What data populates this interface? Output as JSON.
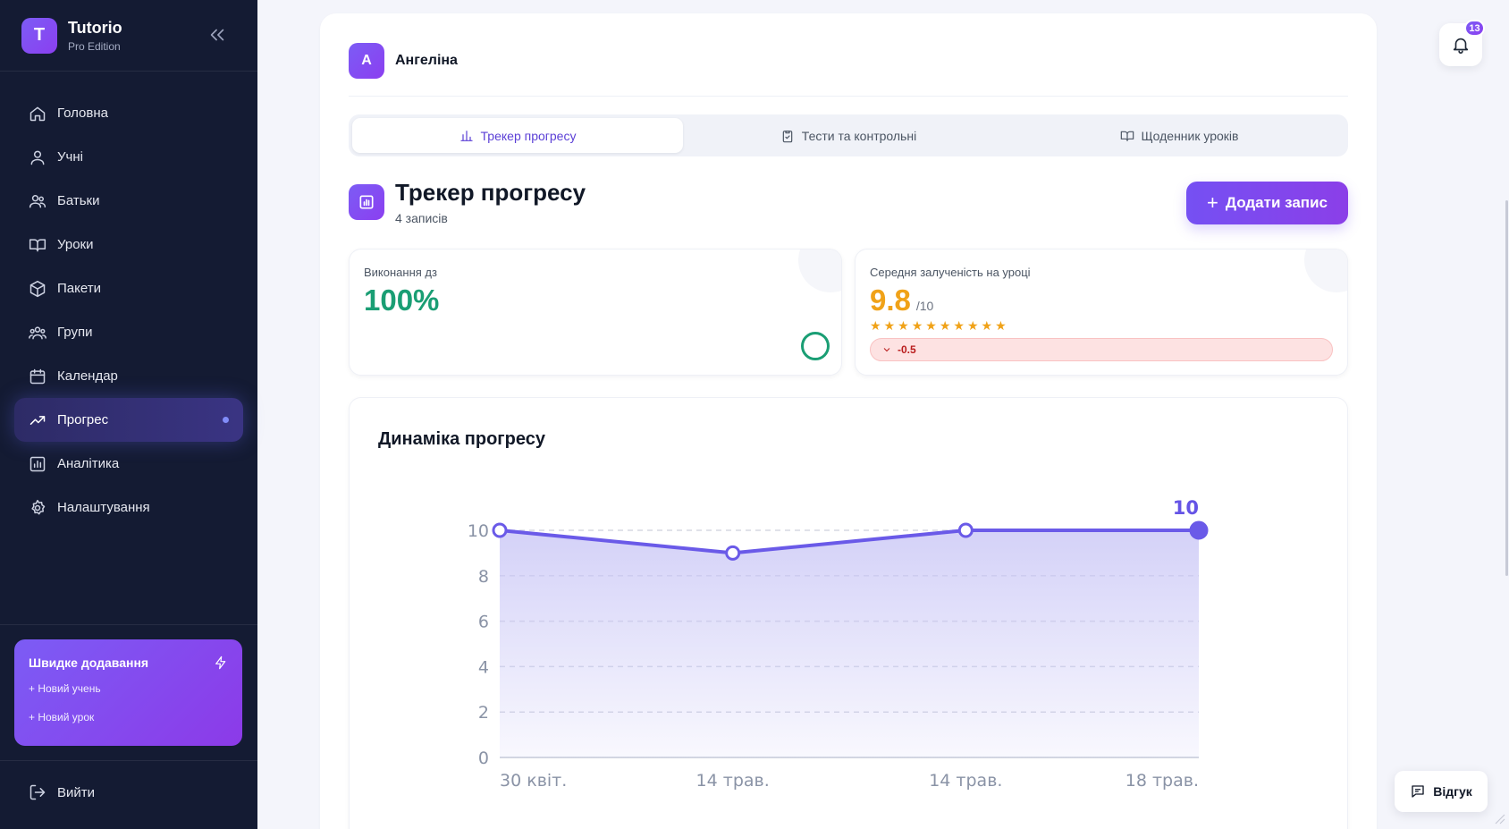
{
  "brand": {
    "initial": "T",
    "title": "Tutorio",
    "subtitle": "Pro Edition"
  },
  "sidebar": {
    "items": [
      {
        "label": "Головна",
        "icon": "home-icon"
      },
      {
        "label": "Учні",
        "icon": "user-icon"
      },
      {
        "label": "Батьки",
        "icon": "users-icon"
      },
      {
        "label": "Уроки",
        "icon": "book-icon"
      },
      {
        "label": "Пакети",
        "icon": "package-icon"
      },
      {
        "label": "Групи",
        "icon": "group-icon"
      },
      {
        "label": "Календар",
        "icon": "calendar-icon"
      },
      {
        "label": "Прогрес",
        "icon": "trending-up-icon",
        "active": true
      },
      {
        "label": "Аналітика",
        "icon": "bar-chart-icon"
      },
      {
        "label": "Налаштування",
        "icon": "gear-icon"
      }
    ],
    "quick_add": {
      "title": "Швидке додавання",
      "new_student": "+ Новий учень",
      "new_lesson": "+ Новий урок"
    },
    "logout": "Вийти"
  },
  "student": {
    "initial": "А",
    "name": "Ангеліна"
  },
  "tabs": [
    {
      "label": "Трекер прогресу",
      "icon": "bar-chart-icon",
      "active": true
    },
    {
      "label": "Тести та контрольні",
      "icon": "clipboard-icon"
    },
    {
      "label": "Щоденник уроків",
      "icon": "book-open-icon"
    }
  ],
  "section": {
    "title": "Трекер прогресу",
    "subtitle": "4 записів",
    "add_button": "Додати запис"
  },
  "stats": {
    "homework": {
      "label": "Виконання дз",
      "value": "100%"
    },
    "engagement": {
      "label": "Середня залученість на уроці",
      "value": "9.8",
      "suffix": "/10",
      "stars": 10,
      "delta": "-0.5"
    }
  },
  "chart_title": "Динаміка прогресу",
  "chart_data": {
    "type": "area",
    "title": "Динаміка прогресу",
    "x": [
      "30 квіт.",
      "14 трав.",
      "14 трав.",
      "18 трав."
    ],
    "values": [
      10,
      9,
      10,
      10
    ],
    "ylim": [
      0,
      10
    ],
    "yticks": [
      0,
      2,
      4,
      6,
      8,
      10
    ],
    "last_label": "10",
    "grid": true,
    "colors": {
      "line": "#6a5ae8",
      "fill": "#c9c6f6"
    }
  },
  "notifications": {
    "count": "13"
  },
  "feedback": "Відгук",
  "colors": {
    "accent": "#7c5cf5",
    "sidebar_bg": "#141b33",
    "success": "#1a9e74",
    "warning": "#f0a218",
    "danger": "#b91c1c"
  }
}
